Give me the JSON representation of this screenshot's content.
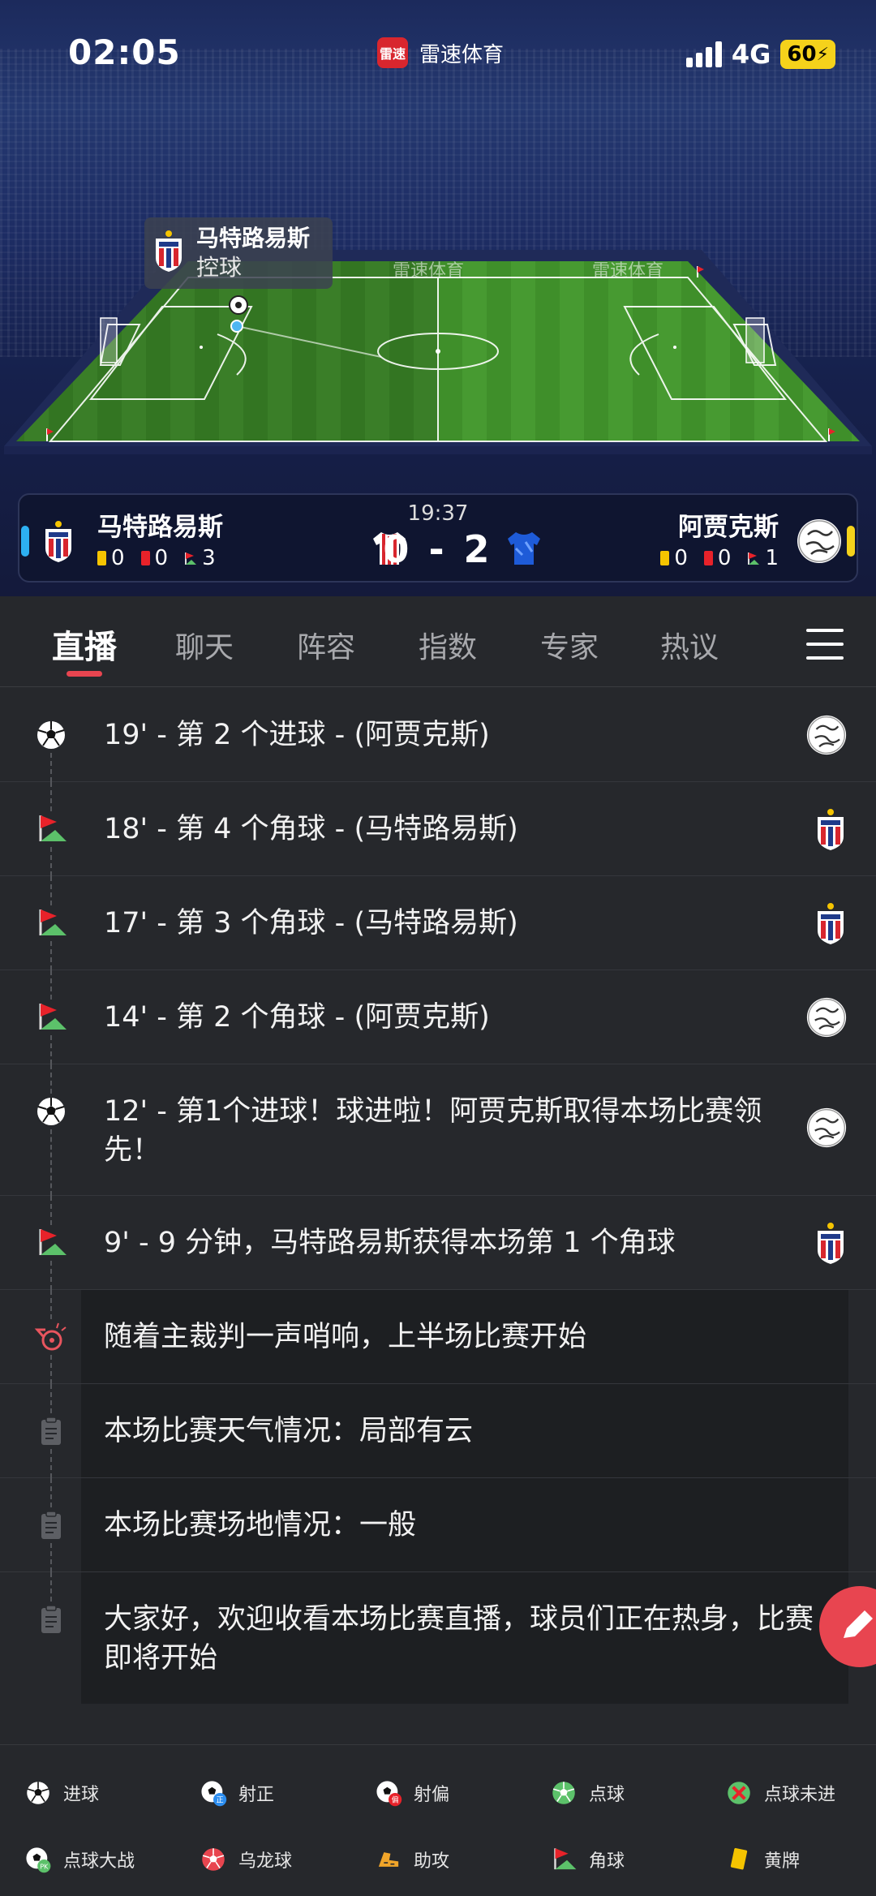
{
  "status_bar": {
    "time": "02:05",
    "app_logo_text": "雷速",
    "app_name": "雷速体育",
    "network": "4G",
    "battery": "60"
  },
  "pitch": {
    "ad_text": "雷速体育",
    "possession_team": "马特路易斯",
    "possession_label": "控球"
  },
  "match": {
    "time": "19:37",
    "score": "0 - 2",
    "home": {
      "name": "马特路易斯",
      "yellow": "0",
      "red": "0",
      "corners": "3"
    },
    "away": {
      "name": "阿贾克斯",
      "yellow": "0",
      "red": "0",
      "corners": "1"
    }
  },
  "tabs": [
    {
      "label": "直播"
    },
    {
      "label": "聊天"
    },
    {
      "label": "阵容"
    },
    {
      "label": "指数"
    },
    {
      "label": "专家"
    },
    {
      "label": "热议"
    }
  ],
  "events": [
    {
      "type": "goal",
      "text": "19' - 第 2 个进球 - (阿贾克斯)",
      "team": "away"
    },
    {
      "type": "corner",
      "text": "18' - 第 4 个角球 - (马特路易斯)",
      "team": "home"
    },
    {
      "type": "corner",
      "text": "17' - 第 3 个角球 - (马特路易斯)",
      "team": "home"
    },
    {
      "type": "corner",
      "text": "14' - 第 2 个角球 - (阿贾克斯)",
      "team": "away"
    },
    {
      "type": "goal",
      "text": "12' - 第1个进球！球进啦！阿贾克斯取得本场比赛领先！",
      "team": "away"
    },
    {
      "type": "corner",
      "text": "9' - 9 分钟，马特路易斯获得本场第 1 个角球",
      "team": "home"
    },
    {
      "type": "whistle",
      "text": "随着主裁判一声哨响，上半场比赛开始"
    },
    {
      "type": "note",
      "text": "本场比赛天气情况：局部有云"
    },
    {
      "type": "note",
      "text": "本场比赛场地情况：一般"
    },
    {
      "type": "note",
      "text": "大家好，欢迎收看本场比赛直播，球员们正在热身，比赛即将开始"
    }
  ],
  "legend": [
    {
      "label": "进球",
      "icon": "goal-icon"
    },
    {
      "label": "射正",
      "icon": "shot-on-target-icon"
    },
    {
      "label": "射偏",
      "icon": "shot-off-target-icon"
    },
    {
      "label": "点球",
      "icon": "penalty-icon"
    },
    {
      "label": "点球未进",
      "icon": "penalty-missed-icon"
    },
    {
      "label": "点球大战",
      "icon": "penalty-shootout-icon"
    },
    {
      "label": "乌龙球",
      "icon": "own-goal-icon"
    },
    {
      "label": "助攻",
      "icon": "assist-icon"
    },
    {
      "label": "角球",
      "icon": "corner-icon"
    },
    {
      "label": "黄牌",
      "icon": "yellow-card-icon"
    }
  ],
  "colors": {
    "accent": "#e84550",
    "home_edge": "#2db0f2",
    "away_edge": "#f5d21b",
    "pitch": "#3f8f2a"
  }
}
